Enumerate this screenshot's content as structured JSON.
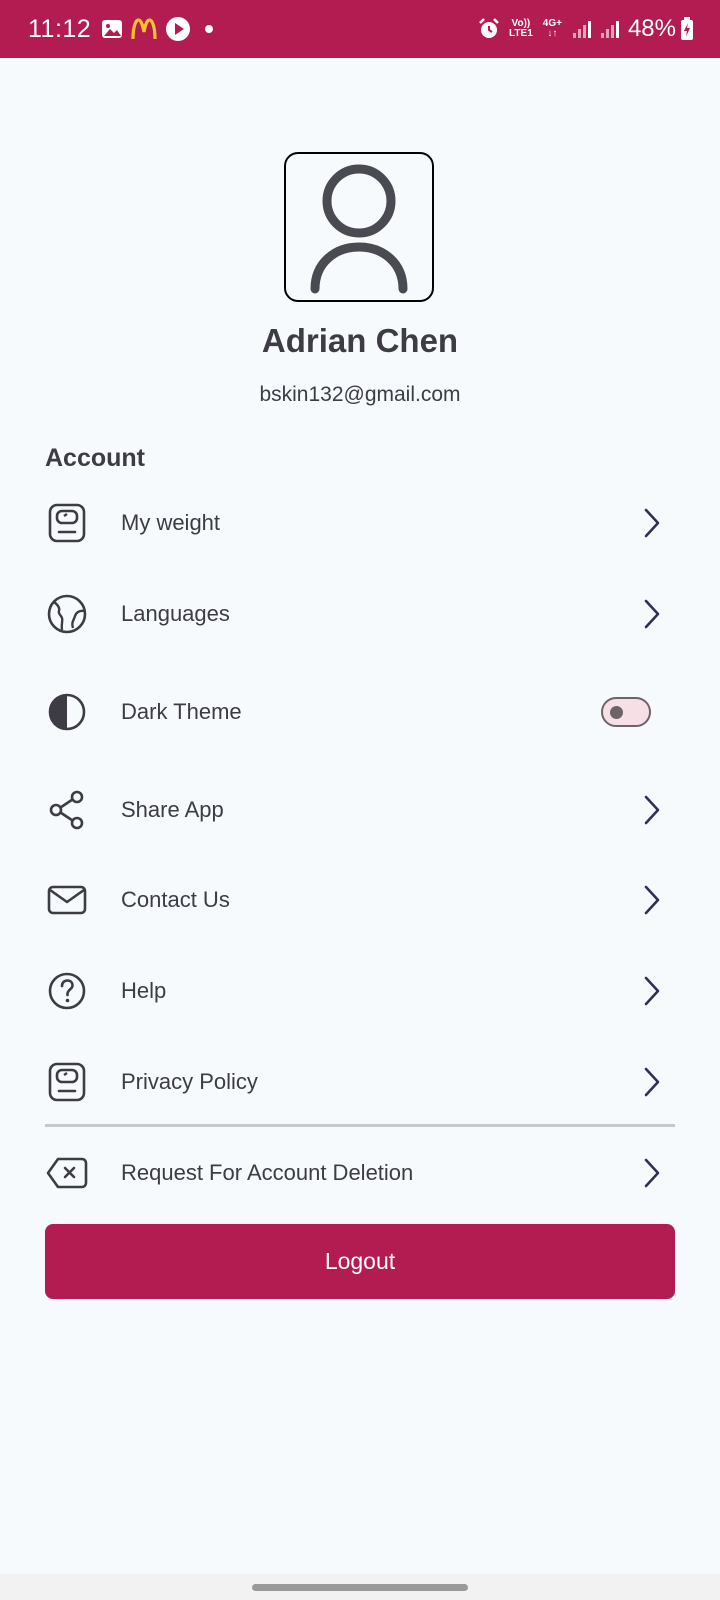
{
  "status_bar": {
    "time": "11:12",
    "network_top": "Vo))",
    "network_bottom": "LTE1",
    "data_top": "4G+",
    "data_bottom": "↓↑",
    "battery": "48%",
    "icons": [
      "gallery-icon",
      "mcdonalds-icon",
      "play-icon",
      "dot-icon",
      "alarm-icon",
      "signal-icon",
      "signal-icon",
      "battery-charging-icon"
    ]
  },
  "profile": {
    "name": "Adrian Chen",
    "email": "bskin132@gmail.com"
  },
  "section_title": "Account",
  "menu": {
    "my_weight": "My weight",
    "languages": "Languages",
    "dark_theme": "Dark Theme",
    "share_app": "Share App",
    "contact_us": "Contact Us",
    "help": "Help",
    "privacy_policy": "Privacy Policy",
    "delete_account": "Request For Account Deletion"
  },
  "dark_theme_enabled": false,
  "logout_label": "Logout",
  "colors": {
    "accent": "#b31c50",
    "background": "#f6fafd",
    "text": "#3d3c44",
    "chevron": "#2f3054"
  }
}
